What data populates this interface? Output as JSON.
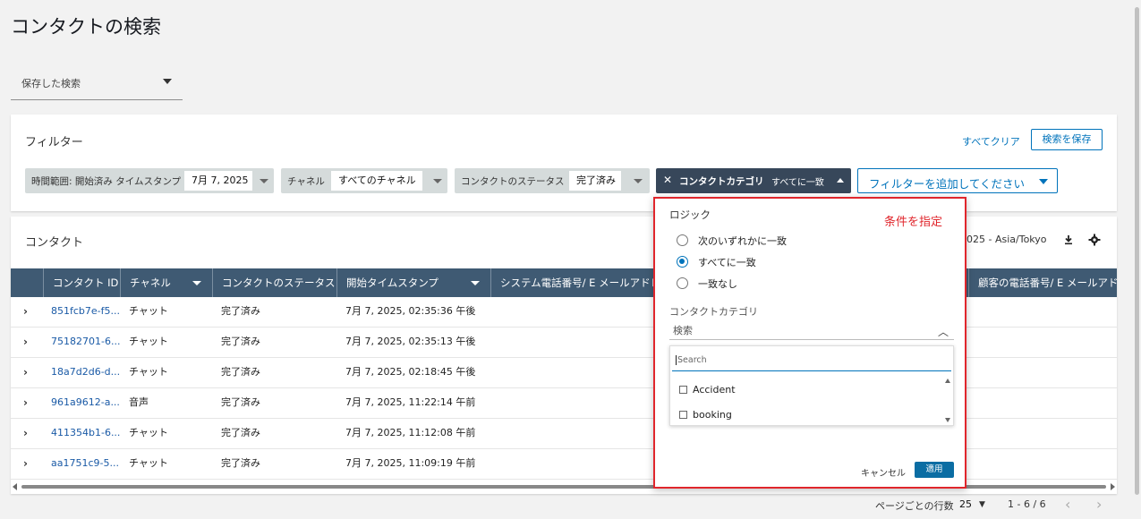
{
  "page": {
    "title": "コンタクトの検索"
  },
  "saved_search": {
    "label": "保存した検索"
  },
  "filters": {
    "title": "フィルター",
    "clear_all": "すべてクリア",
    "save_search": "検索を保存",
    "time_range": {
      "label": "時間範囲: 開始済み タイムスタンプ",
      "value": "7月 7, 2025"
    },
    "channel": {
      "label": "チャネル",
      "value": "すべてのチャネル"
    },
    "status": {
      "label": "コンタクトのステータス",
      "value": "完了済み"
    },
    "category": {
      "close": "✕",
      "label": "コンタクトカテゴリ",
      "value": "すべてに一致"
    },
    "add_filter": "フィルターを追加してください"
  },
  "contacts": {
    "title": "コンタクト",
    "timezone": "025 - Asia/Tokyo",
    "columns": [
      "コンタクト ID",
      "チャネル",
      "コンタクトのステータス",
      "開始タイムスタンプ",
      "システム電話番号/ E メールアドレス",
      "顧客の電話番号/ E メールアドレス"
    ],
    "rows": [
      {
        "id": "851fcb7e-f5...",
        "channel": "チャット",
        "status": "完了済み",
        "start": "7月 7, 2025, 02:35:36 午後"
      },
      {
        "id": "75182701-6...",
        "channel": "チャット",
        "status": "完了済み",
        "start": "7月 7, 2025, 02:35:13 午後"
      },
      {
        "id": "18a7d2d6-d...",
        "channel": "チャット",
        "status": "完了済み",
        "start": "7月 7, 2025, 02:18:45 午後"
      },
      {
        "id": "961a9612-a...",
        "channel": "音声",
        "status": "完了済み",
        "start": "7月 7, 2025, 11:22:14 午前"
      },
      {
        "id": "411354b1-6...",
        "channel": "チャット",
        "status": "完了済み",
        "start": "7月 7, 2025, 11:12:08 午前"
      },
      {
        "id": "aa1751c9-5...",
        "channel": "チャット",
        "status": "完了済み",
        "start": "7月 7, 2025, 11:09:19 午前"
      }
    ]
  },
  "pagination": {
    "rows_per_page_label": "ページごとの行数",
    "rows_per_page": "25",
    "range": "1 - 6 / 6"
  },
  "popover": {
    "logic_title": "ロジック",
    "annotation": "条件を指定",
    "options": [
      {
        "label": "次のいずれかに一致",
        "selected": false
      },
      {
        "label": "すべてに一致",
        "selected": true
      },
      {
        "label": "一致なし",
        "selected": false
      }
    ],
    "category_title": "コンタクトカテゴリ",
    "category_search": "検索",
    "list_search_placeholder": "Search",
    "items": [
      "Accident",
      "booking"
    ],
    "cancel": "キャンセル",
    "apply": "適用"
  },
  "colors": {
    "accent": "#0073bb",
    "header": "#3f5a73",
    "annotation": "#e0262c"
  }
}
